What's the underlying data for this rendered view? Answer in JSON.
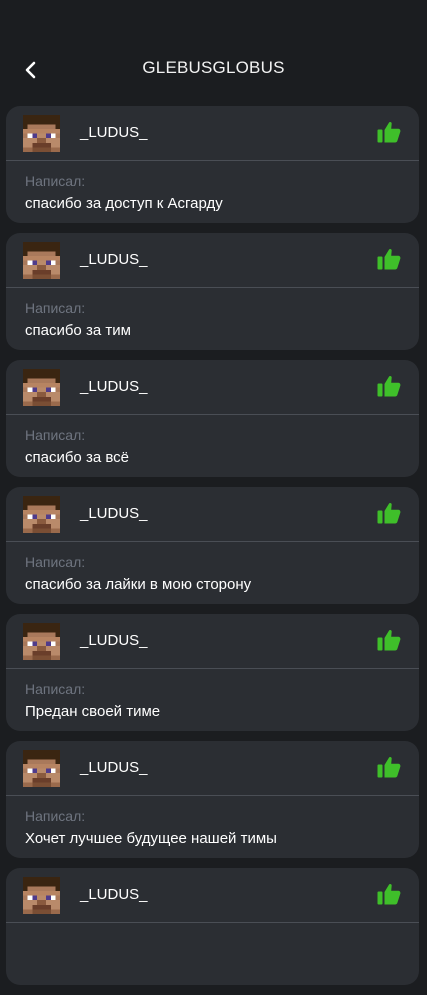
{
  "header": {
    "title": "GLEBUSGLOBUS",
    "back_icon": "chevron-left-icon"
  },
  "colors": {
    "background": "#1b1d20",
    "card": "#2b2e33",
    "divider": "#4a4e55",
    "like_green": "#3fbf2a",
    "caption": "#6f7580"
  },
  "reviews": [
    {
      "user": "_LUDUS_",
      "caption": "Написал:",
      "message": "спасибо за доступ к Асгарду",
      "icon": "thumbs-up-icon"
    },
    {
      "user": "_LUDUS_",
      "caption": "Написал:",
      "message": "спасибо за тим",
      "icon": "thumbs-up-icon"
    },
    {
      "user": "_LUDUS_",
      "caption": "Написал:",
      "message": "спасибо за всё",
      "icon": "thumbs-up-icon"
    },
    {
      "user": "_LUDUS_",
      "caption": "Написал:",
      "message": "спасибо за лайки в мою сторону",
      "icon": "thumbs-up-icon"
    },
    {
      "user": "_LUDUS_",
      "caption": "Написал:",
      "message": "Предан своей тиме",
      "icon": "thumbs-up-icon"
    },
    {
      "user": "_LUDUS_",
      "caption": "Написал:",
      "message": "Хочет лучшее будущее нашей тимы",
      "icon": "thumbs-up-icon"
    },
    {
      "user": "_LUDUS_",
      "caption": "",
      "message": "",
      "icon": "thumbs-up-icon"
    }
  ]
}
